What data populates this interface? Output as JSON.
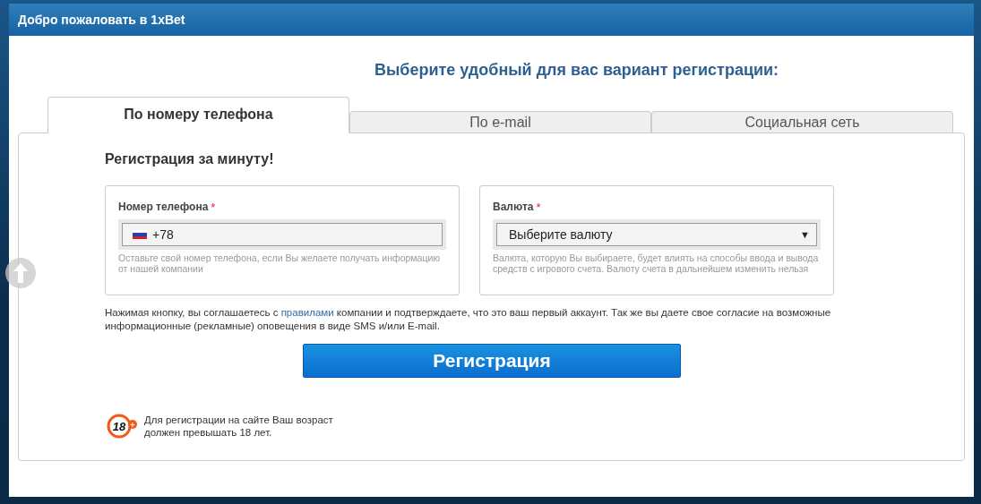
{
  "window": {
    "title": "Добро пожаловать в 1xBet"
  },
  "heading": "Выберите удобный для вас вариант регистрации:",
  "tabs": [
    {
      "label": "По номеру телефона",
      "selected": true
    },
    {
      "label": "По e-mail",
      "selected": false
    },
    {
      "label": "Социальная сеть",
      "selected": false
    }
  ],
  "form": {
    "title": "Регистрация за минуту!",
    "fields": [
      {
        "kind": "phone",
        "label": "Номер телефона",
        "required_mark": "*",
        "value": "+78",
        "hint": "Оставьте свой номер телефона, если Вы желаете получать информацию от нашей компании"
      },
      {
        "kind": "select",
        "label": "Валюта",
        "required_mark": "*",
        "value": "Выберите валюту",
        "caret": "▼",
        "hint": "Валюта, которую Вы выбираете, будет влиять на способы ввода и вывода средств с игрового счета. Валюту счета в дальнейшем изменить нельзя"
      }
    ],
    "consent": {
      "before": "Нажимая кнопку, вы соглашаетесь с ",
      "link": "правилами",
      "after": " компании и подтверждаете, что это ваш первый аккаунт. Так же вы даете свое согласие на возможные информационные (рекламные) оповещения в виде SMS и/или E-mail."
    },
    "submit": "Регистрация",
    "age": {
      "badge": "18",
      "plus": "+",
      "text": "Для регистрации на сайте Ваш возраст должен превышать 18 лет."
    }
  }
}
